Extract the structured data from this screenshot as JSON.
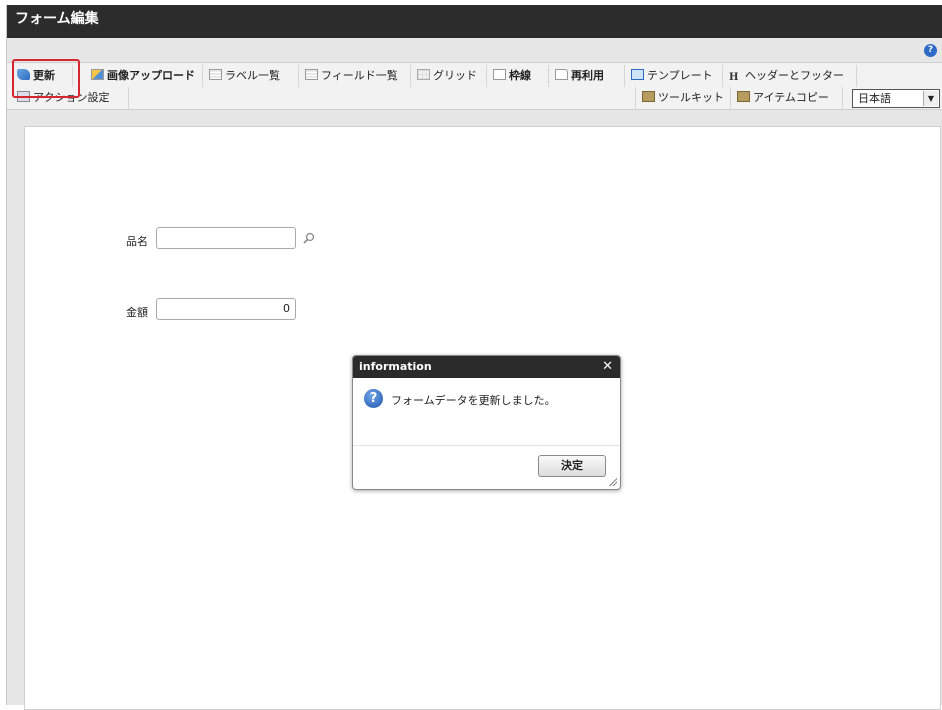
{
  "window": {
    "title": "フォーム編集"
  },
  "toolbar": {
    "row1": [
      {
        "label": "更新",
        "icon": "update-icon"
      },
      {
        "label": "画像アップロード",
        "icon": "image-upload-icon"
      },
      {
        "label": "ラベル一覧",
        "icon": "label-list-icon"
      },
      {
        "label": "フィールド一覧",
        "icon": "field-list-icon"
      },
      {
        "label": "グリッド",
        "icon": "grid-icon"
      },
      {
        "label": "枠線",
        "icon": "border-icon"
      },
      {
        "label": "再利用",
        "icon": "reuse-icon"
      },
      {
        "label": "テンプレート",
        "icon": "template-icon"
      },
      {
        "label": "ヘッダーとフッター",
        "icon": "header-footer-icon"
      }
    ],
    "action_settings": "アクション設定",
    "toolkit": "ツールキット",
    "item_copy": "アイテムコピー",
    "language": "日本語",
    "highlight_color": "#d6262f"
  },
  "form": {
    "item_name_label": "品名",
    "item_name_value": "",
    "amount_label": "金額",
    "amount_value": "0"
  },
  "dialog": {
    "title": "information",
    "message": "フォームデータを更新しました。",
    "ok_label": "決定"
  }
}
